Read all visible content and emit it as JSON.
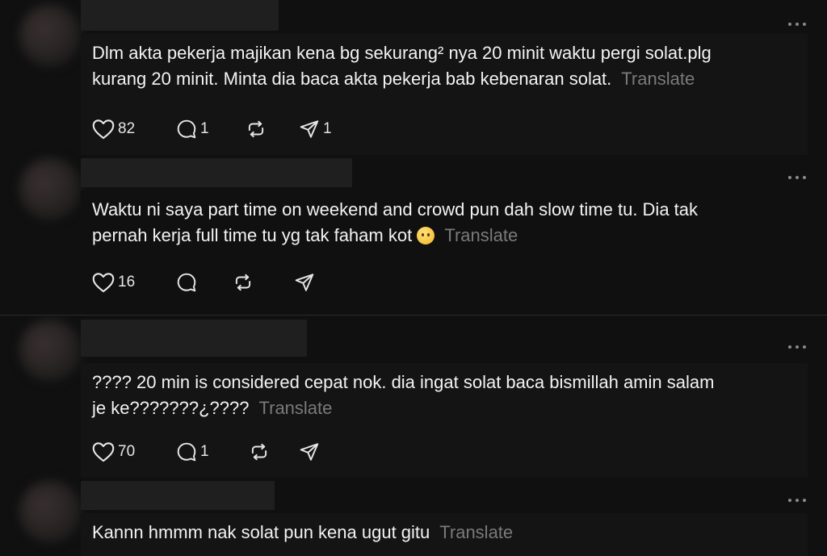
{
  "posts": [
    {
      "text_lines": [
        "Dlm akta pekerja majikan kena bg sekurang² nya 20 minit waktu pergi solat.plg",
        "kurang 20 minit. Minta dia baca akta pekerja bab kebenaran solat."
      ],
      "translate": "Translate",
      "likes": "82",
      "replies": "1",
      "reposts": "",
      "shares": "1"
    },
    {
      "text_lines": [
        "Waktu ni saya part time on weekend and crowd pun dah slow time tu. Dia tak",
        "pernah kerja full time tu yg tak faham kot"
      ],
      "emoji": "face-holding-back-tears",
      "translate": "Translate",
      "likes": "16",
      "replies": "",
      "reposts": "",
      "shares": ""
    },
    {
      "text_lines": [
        "???? 20 min is considered cepat nok. dia ingat solat baca bismillah amin salam",
        "je ke???????¿????"
      ],
      "translate": "Translate",
      "likes": "70",
      "replies": "1",
      "reposts": "",
      "shares": ""
    },
    {
      "text_lines": [
        "Kannn hmmm nak solat pun kena ugut gitu"
      ],
      "translate": "Translate"
    }
  ]
}
